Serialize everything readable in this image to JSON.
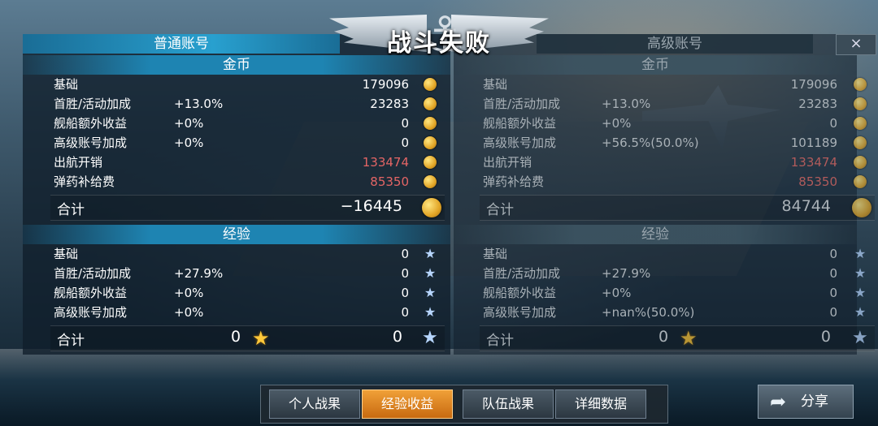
{
  "title": "战斗失败",
  "close_icon": "×",
  "accounts": {
    "normal": {
      "tab_label": "普通账号",
      "gold_section": "金币",
      "gold_rows": [
        {
          "label": "基础",
          "pct": "",
          "value": "179096",
          "red": false
        },
        {
          "label": "首胜/活动加成",
          "pct": "+13.0%",
          "value": "23283",
          "red": false
        },
        {
          "label": "舰船额外收益",
          "pct": "+0%",
          "value": "0",
          "red": false
        },
        {
          "label": "高级账号加成",
          "pct": "+0%",
          "value": "0",
          "red": false
        },
        {
          "label": "出航开销",
          "pct": "",
          "value": "133474",
          "red": true
        },
        {
          "label": "弹药补给费",
          "pct": "",
          "value": "85350",
          "red": true
        }
      ],
      "gold_total_label": "合计",
      "gold_total": "−16445",
      "exp_section": "经验",
      "exp_rows": [
        {
          "label": "基础",
          "pct": "",
          "value": "0"
        },
        {
          "label": "首胜/活动加成",
          "pct": "+27.9%",
          "value": "0"
        },
        {
          "label": "舰船额外收益",
          "pct": "+0%",
          "value": "0"
        },
        {
          "label": "高级账号加成",
          "pct": "+0%",
          "value": "0"
        }
      ],
      "exp_total_label": "合计",
      "exp_total_a": "0",
      "exp_total_b": "0"
    },
    "premium": {
      "tab_label": "高级账号",
      "gold_section": "金币",
      "gold_rows": [
        {
          "label": "基础",
          "pct": "",
          "value": "179096",
          "red": false
        },
        {
          "label": "首胜/活动加成",
          "pct": "+13.0%",
          "value": "23283",
          "red": false
        },
        {
          "label": "舰船额外收益",
          "pct": "+0%",
          "value": "0",
          "red": false
        },
        {
          "label": "高级账号加成",
          "pct": "+56.5%(50.0%)",
          "value": "101189",
          "red": false
        },
        {
          "label": "出航开销",
          "pct": "",
          "value": "133474",
          "red": true
        },
        {
          "label": "弹药补给费",
          "pct": "",
          "value": "85350",
          "red": true
        }
      ],
      "gold_total_label": "合计",
      "gold_total": "84744",
      "exp_section": "经验",
      "exp_rows": [
        {
          "label": "基础",
          "pct": "",
          "value": "0"
        },
        {
          "label": "首胜/活动加成",
          "pct": "+27.9%",
          "value": "0"
        },
        {
          "label": "舰船额外收益",
          "pct": "+0%",
          "value": "0"
        },
        {
          "label": "高级账号加成",
          "pct": "+nan%(50.0%)",
          "value": "0"
        }
      ],
      "exp_total_label": "合计",
      "exp_total_a": "0",
      "exp_total_b": "0"
    }
  },
  "tabs": [
    {
      "label": "个人战果",
      "active": false
    },
    {
      "label": "经验收益",
      "active": true
    },
    {
      "label": "队伍战果",
      "active": false
    },
    {
      "label": "详细数据",
      "active": false
    }
  ],
  "share_label": "分享"
}
